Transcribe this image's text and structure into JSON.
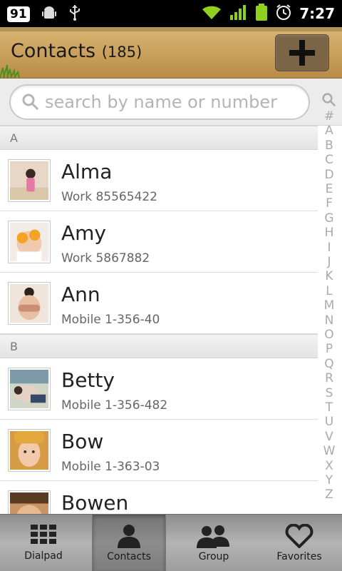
{
  "status_bar": {
    "badge": "91",
    "time": "7:27",
    "icons": [
      "notification-badge",
      "android-icon",
      "usb-icon",
      "wifi-icon",
      "signal-icon",
      "battery-icon",
      "alarm-icon"
    ],
    "accent": "#8ed11f"
  },
  "header": {
    "title": "Contacts",
    "count": "(185)",
    "add_button_icon": "plus-icon"
  },
  "search": {
    "placeholder": "search by name or number",
    "value": ""
  },
  "sections": [
    {
      "letter": "A",
      "contacts": [
        {
          "name": "Alma",
          "detail": "Work 85565422"
        },
        {
          "name": "Amy",
          "detail": "Work 5867882"
        },
        {
          "name": "Ann",
          "detail": "Mobile 1-356-40"
        }
      ]
    },
    {
      "letter": "B",
      "contacts": [
        {
          "name": "Betty",
          "detail": "Mobile 1-356-482"
        },
        {
          "name": "Bow",
          "detail": "Mobile 1-363-03"
        },
        {
          "name": "Bowen",
          "detail": ""
        }
      ]
    }
  ],
  "index": [
    "#",
    "A",
    "B",
    "C",
    "D",
    "E",
    "F",
    "G",
    "H",
    "I",
    "J",
    "K",
    "L",
    "M",
    "N",
    "O",
    "P",
    "Q",
    "R",
    "S",
    "T",
    "U",
    "V",
    "W",
    "X",
    "Y",
    "Z"
  ],
  "tabs": [
    {
      "label": "Dialpad",
      "icon": "dialpad-icon",
      "active": false
    },
    {
      "label": "Contacts",
      "icon": "contact-person-icon",
      "active": true
    },
    {
      "label": "Group",
      "icon": "group-icon",
      "active": false
    },
    {
      "label": "Favorites",
      "icon": "heart-icon",
      "active": false
    }
  ]
}
